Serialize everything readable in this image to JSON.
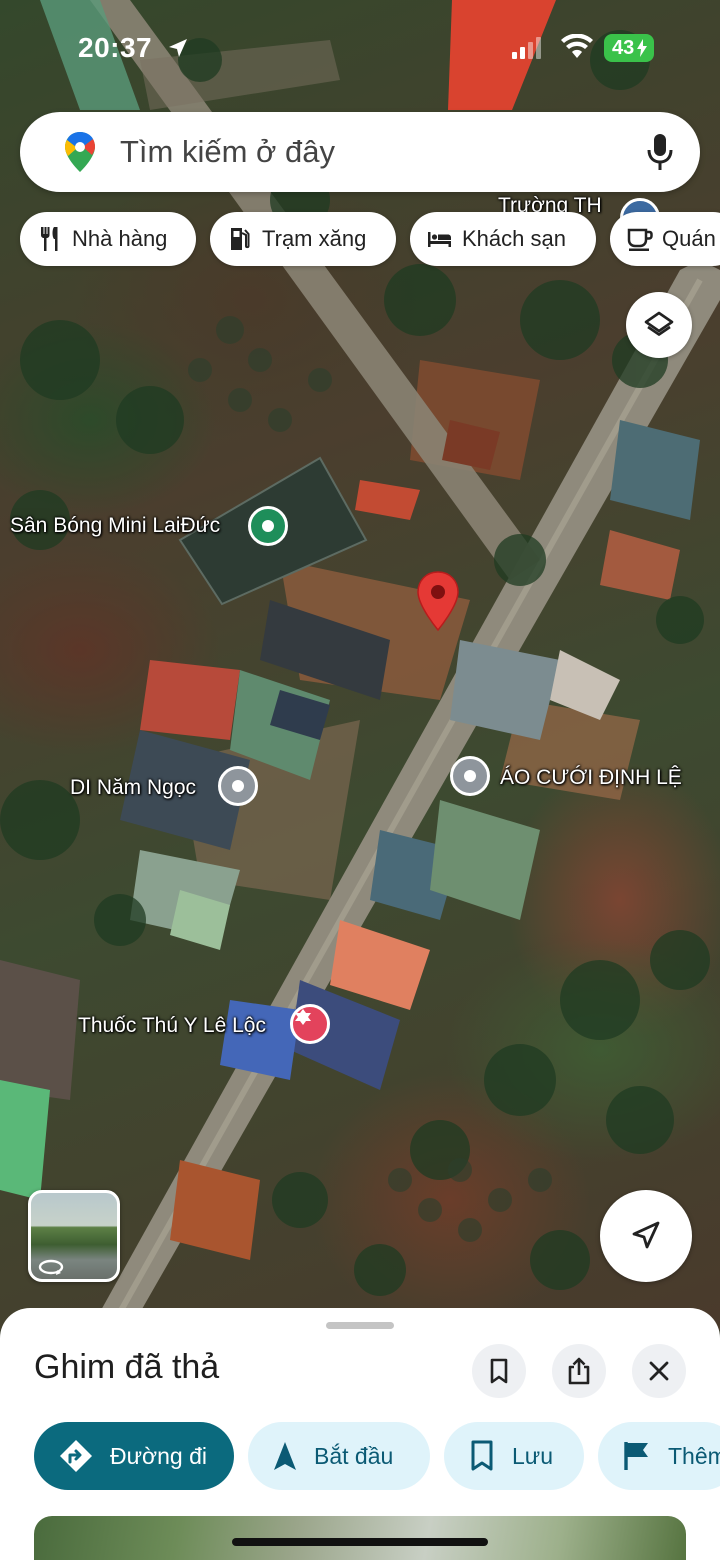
{
  "status_bar": {
    "time": "20:37",
    "battery": "43"
  },
  "search": {
    "placeholder": "Tìm kiếm ở đây"
  },
  "chips": [
    {
      "label": "Nhà hàng",
      "icon": "fork-knife-icon"
    },
    {
      "label": "Trạm xăng",
      "icon": "gas-station-icon"
    },
    {
      "label": "Khách sạn",
      "icon": "bed-icon"
    },
    {
      "label": "Quán",
      "icon": "coffee-cup-icon"
    }
  ],
  "map": {
    "labels": {
      "school": "Trường TH",
      "football": "Sân Bóng Mini LaiĐức",
      "nam_ngoc": "DI Năm Ngọc",
      "wedding": "ÁO CƯỚI ĐỊNH LỆ",
      "vet": "Thuốc Thú Y Lê Lộc"
    },
    "pin_color": "#e53935"
  },
  "sheet": {
    "title": "Ghim đã thả",
    "actions": {
      "directions": "Đường đi",
      "start": "Bắt đầu",
      "save": "Lưu",
      "more": "Thêm"
    }
  },
  "colors": {
    "accent": "#0b6a7e",
    "pill_light": "#dff3fa"
  }
}
